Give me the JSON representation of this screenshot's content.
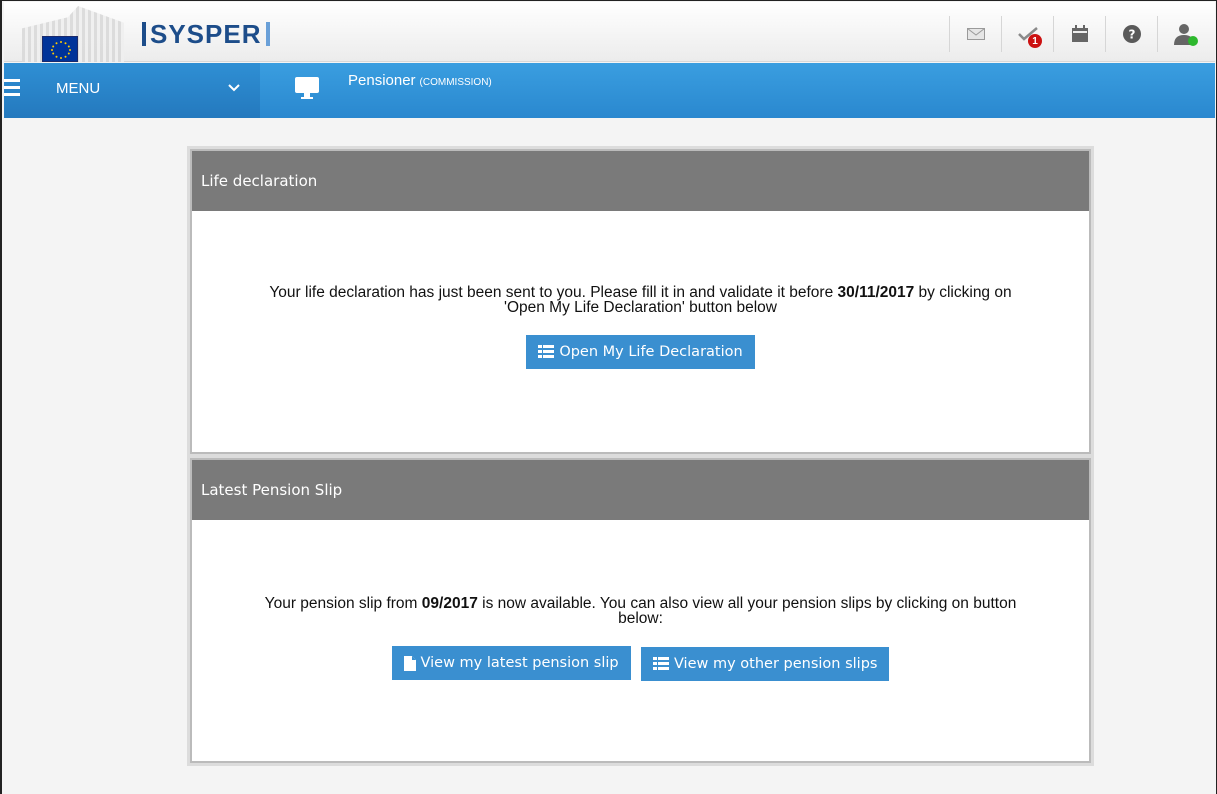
{
  "header": {
    "brand": "SYSPER",
    "icons": [
      "mail-icon",
      "tasks-check-icon",
      "calendar-icon",
      "help-icon",
      "user-icon"
    ],
    "tasks_badge": "1"
  },
  "nav": {
    "menu_label": "MENU",
    "context_title": "Pensioner",
    "context_sub": "(COMMISSION)"
  },
  "life_declaration": {
    "title": "Life declaration",
    "text_before": "Your life declaration has just been sent to you. Please fill it in and validate it before ",
    "deadline": "30/11/2017",
    "text_after": " by clicking on 'Open My Life Declaration' button below",
    "button_label": "Open My Life Declaration"
  },
  "pension_slip": {
    "title": "Latest Pension Slip",
    "text_before": "Your pension slip from ",
    "period": "09/2017",
    "text_after": " is now available. You can also view all your pension slips by clicking on button below:",
    "latest_button_label": "View my latest pension slip",
    "other_button_label": "View my other pension slips"
  },
  "colors": {
    "nav_blue": "#2a88cf",
    "button_blue": "#3a8fd0",
    "panel_header": "#7a7a7a",
    "brand_blue": "#1d4d8a"
  }
}
